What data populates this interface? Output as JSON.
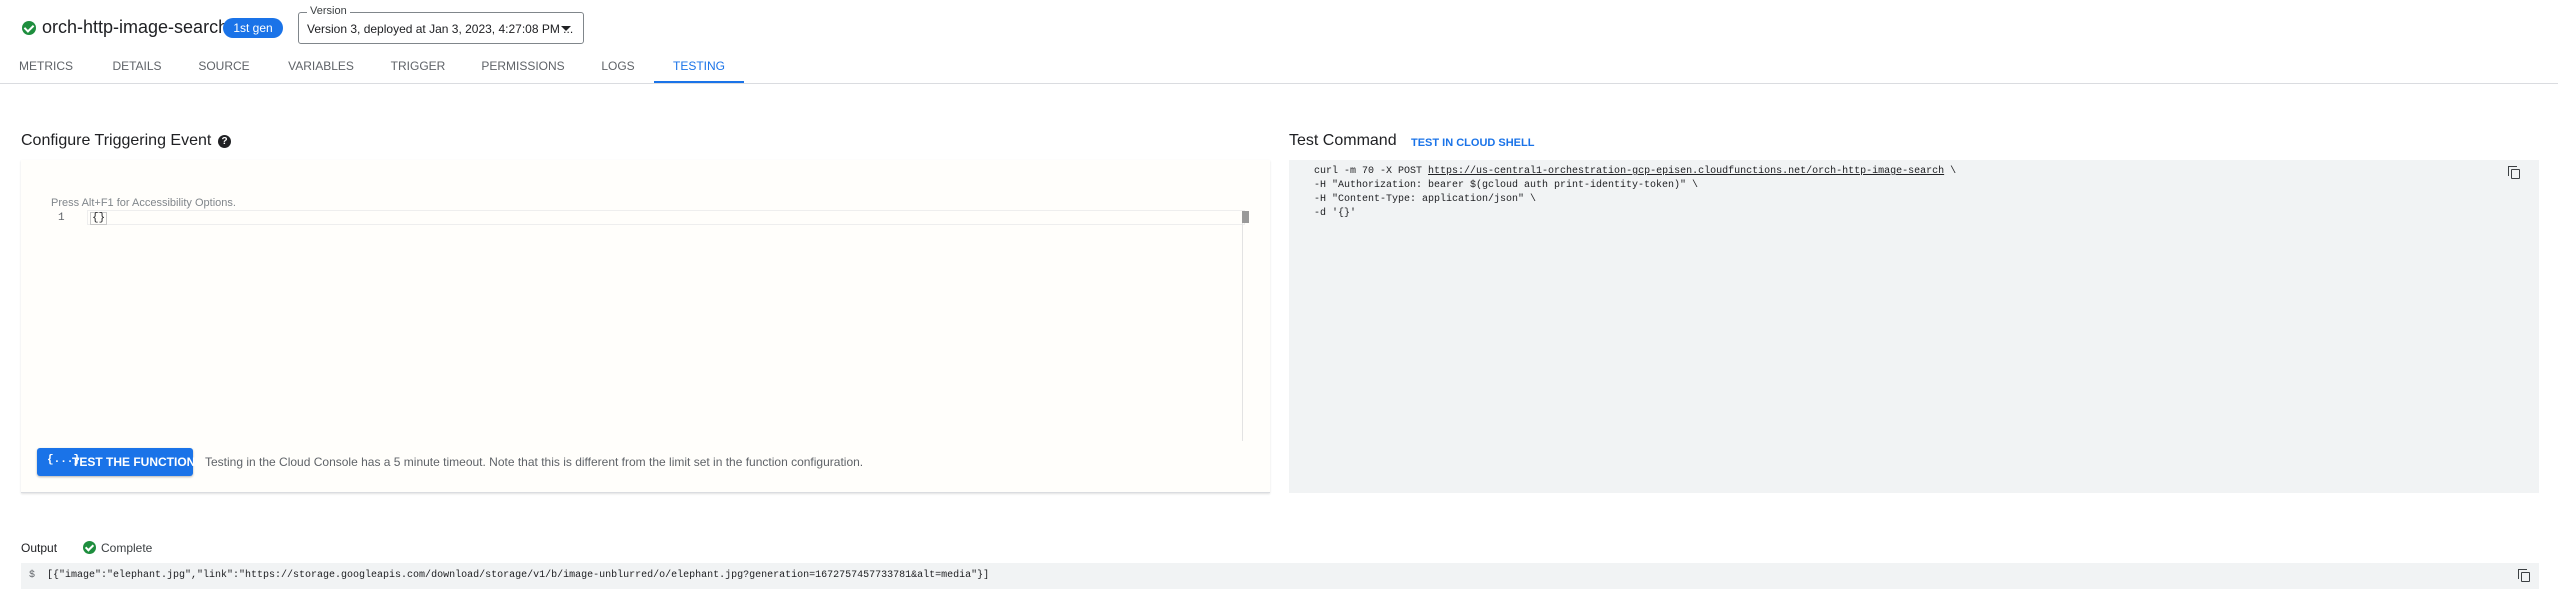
{
  "header": {
    "function_name": "orch-http-image-search",
    "gen_badge": "1st gen",
    "version_label": "Version",
    "version_value": "Version 3, deployed at Jan 3, 2023, 4:27:08 PM ..."
  },
  "tabs": [
    {
      "label": "METRICS",
      "active": false
    },
    {
      "label": "DETAILS",
      "active": false
    },
    {
      "label": "SOURCE",
      "active": false
    },
    {
      "label": "VARIABLES",
      "active": false
    },
    {
      "label": "TRIGGER",
      "active": false
    },
    {
      "label": "PERMISSIONS",
      "active": false
    },
    {
      "label": "LOGS",
      "active": false
    },
    {
      "label": "TESTING",
      "active": true
    }
  ],
  "trigger": {
    "title": "Configure Triggering Event",
    "help_glyph": "?",
    "editor_hint": "Press Alt+F1 for Accessibility Options.",
    "line_number": "1",
    "code": "{}",
    "test_button_icon": "{...}",
    "test_button_label": "TEST THE FUNCTION",
    "timeout_note": "Testing in the Cloud Console has a 5 minute timeout. Note that this is different from the limit set in the function configuration."
  },
  "command": {
    "title": "Test Command",
    "cloud_shell_link": "TEST IN CLOUD SHELL",
    "line1_prefix": "curl -m 70 -X POST ",
    "line1_url": "https://us-central1-orchestration-gcp-episen.cloudfunctions.net/orch-http-image-search",
    "line1_suffix": " \\",
    "line2": "-H \"Authorization: bearer $(gcloud auth print-identity-token)\" \\",
    "line3": "-H \"Content-Type: application/json\" \\",
    "line4": "-d '{}'"
  },
  "output": {
    "label": "Output",
    "status": "Complete",
    "prompt": "$",
    "text": "[{\"image\":\"elephant.jpg\",\"link\":\"https://storage.googleapis.com/download/storage/v1/b/image-unblurred/o/elephant.jpg?generation=1672757457733781&alt=media\"}]"
  },
  "colors": {
    "accent": "#1a73e8",
    "success": "#1e8e3e"
  }
}
